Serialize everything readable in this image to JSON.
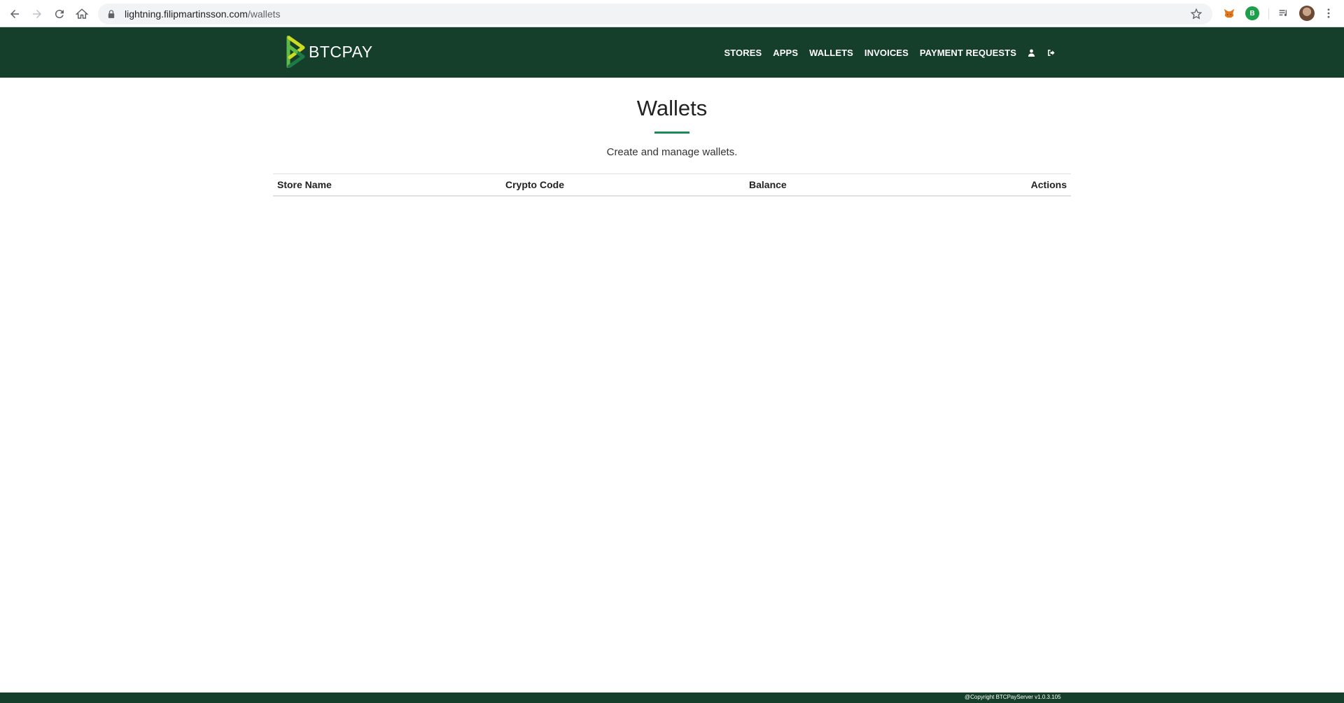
{
  "browser": {
    "url_host": "lightning.filipmartinsson.com",
    "url_path": "/wallets"
  },
  "header": {
    "brand": "BTCPAY",
    "nav": [
      {
        "label": "STORES"
      },
      {
        "label": "APPS"
      },
      {
        "label": "WALLETS"
      },
      {
        "label": "INVOICES"
      },
      {
        "label": "PAYMENT REQUESTS"
      }
    ],
    "icons": [
      "user-icon",
      "logout-icon"
    ],
    "background_color": "#153f2a"
  },
  "main": {
    "title": "Wallets",
    "subtitle": "Create and manage wallets.",
    "accent_color": "#1e8a5b",
    "table": {
      "columns": [
        "Store Name",
        "Crypto Code",
        "Balance",
        "Actions"
      ],
      "rows": []
    }
  },
  "footer": {
    "text": "@Copyright BTCPayServer v1.0.3.105"
  }
}
